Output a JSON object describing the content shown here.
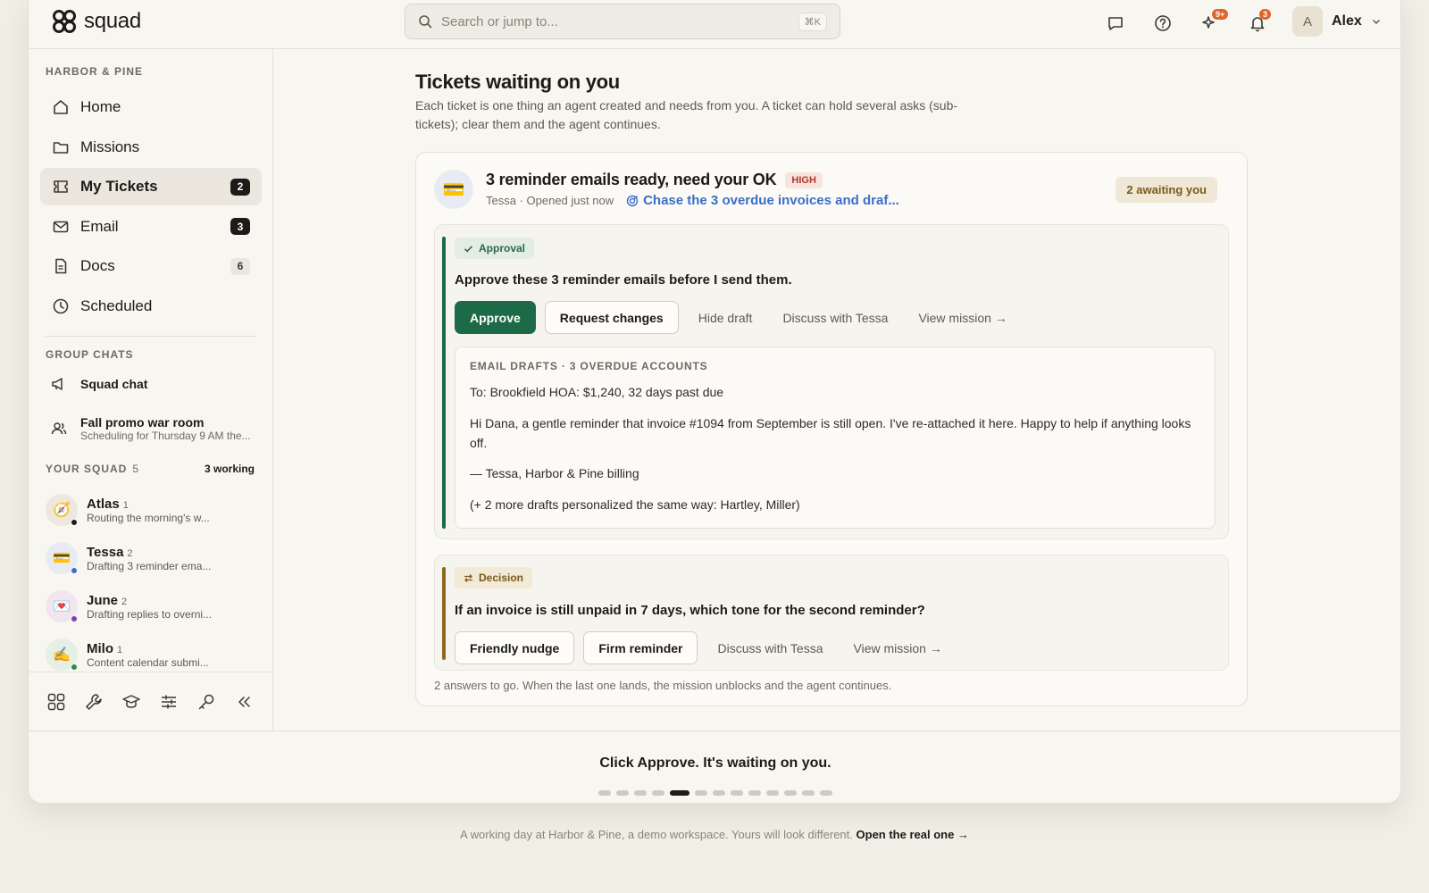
{
  "app": {
    "name": "squad"
  },
  "search": {
    "placeholder": "Search or jump to...",
    "shortcut": "⌘K"
  },
  "topbar": {
    "sparkle_badge": "9+",
    "bell_badge": "3"
  },
  "user": {
    "initial": "A",
    "name": "Alex"
  },
  "sidebar": {
    "workspace": "HARBOR & PINE",
    "nav": [
      {
        "label": "Home",
        "icon": "home-icon"
      },
      {
        "label": "Missions",
        "icon": "folder-icon"
      },
      {
        "label": "My Tickets",
        "icon": "ticket-icon",
        "count": "2"
      },
      {
        "label": "Email",
        "icon": "mail-icon",
        "count": "3"
      },
      {
        "label": "Docs",
        "icon": "doc-icon",
        "count": "6"
      },
      {
        "label": "Scheduled",
        "icon": "clock-icon"
      }
    ],
    "group_chats_label": "GROUP CHATS",
    "chats": [
      {
        "title": "Squad chat",
        "subtitle": ""
      },
      {
        "title": "Fall promo war room",
        "subtitle": "Scheduling for Thursday 9 AM the..."
      }
    ],
    "squad_label": "YOUR SQUAD",
    "squad_count": "5",
    "working": "3 working",
    "agents": [
      {
        "name": "Atlas",
        "count": "1",
        "status": "Routing the morning's w...",
        "emoji": "🧭",
        "dot": "#1c1b18"
      },
      {
        "name": "Tessa",
        "count": "2",
        "status": "Drafting 3 reminder ema...",
        "emoji": "💳",
        "dot": "#3c6ec8"
      },
      {
        "name": "June",
        "count": "2",
        "status": "Drafting replies to overni...",
        "emoji": "💌",
        "dot": "#7b3fb8"
      },
      {
        "name": "Milo",
        "count": "1",
        "status": "Content calendar submi...",
        "emoji": "✍️",
        "dot": "#2d8a4a"
      }
    ]
  },
  "main": {
    "title": "Tickets waiting on you",
    "subtitle": "Each ticket is one thing an agent created and needs from you. A ticket can hold several asks (sub-tickets); clear them and the agent continues.",
    "ticket": {
      "title": "3 reminder emails ready, need your OK",
      "priority": "HIGH",
      "meta": "Tessa · Opened just now",
      "mission": "Chase the 3 overdue invoices and draf...",
      "awaiting": "2 awaiting you",
      "approval": {
        "tag": "Approval",
        "question": "Approve these 3 reminder emails before I send them.",
        "approve": "Approve",
        "request": "Request changes",
        "hide": "Hide draft",
        "discuss": "Discuss with Tessa",
        "view": "View mission →",
        "draft_label": "EMAIL DRAFTS · 3 OVERDUE ACCOUNTS",
        "to": "To: Brookfield HOA: $1,240, 32 days past due",
        "body": "Hi Dana, a gentle reminder that invoice #1094 from September is still open. I've re-attached it here. Happy to help if anything looks off.",
        "sign": "— Tessa, Harbor & Pine billing",
        "more": "(+ 2 more drafts personalized the same way: Hartley, Miller)"
      },
      "decision": {
        "tag": "Decision",
        "question": "If an invoice is still unpaid in 7 days, which tone for the second reminder?",
        "opt1": "Friendly nudge",
        "opt2": "Firm reminder",
        "discuss": "Discuss with Tessa",
        "view": "View mission →"
      },
      "footer": "2 answers to go. When the last one lands, the mission unblocks and the agent continues."
    }
  },
  "tour": {
    "hint": "Click Approve. It's waiting on you.",
    "steps": 13,
    "current": 5
  },
  "footer": {
    "text": "A working day at Harbor & Pine, a demo workspace. Yours will look different.",
    "link": "Open the real one →"
  }
}
